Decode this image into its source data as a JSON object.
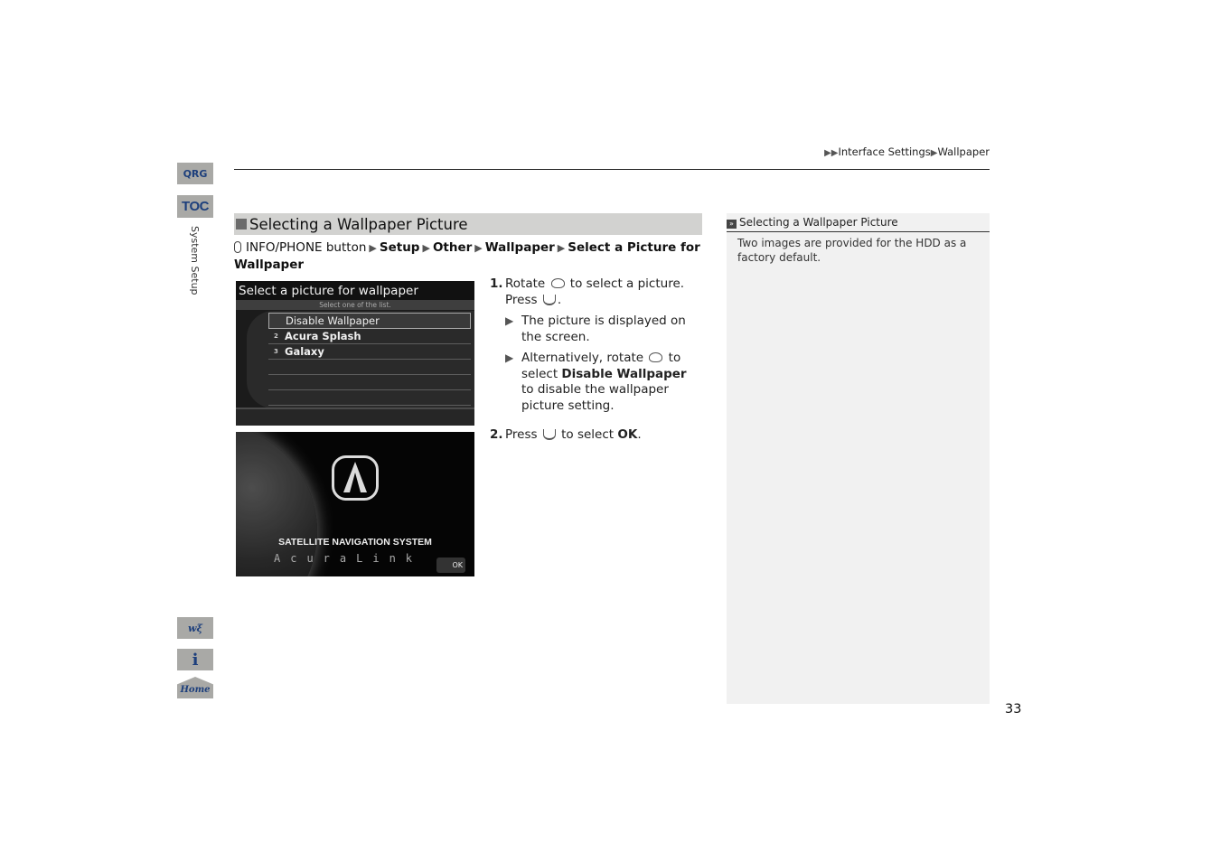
{
  "breadcrumb": {
    "prefix_arrows": "▶▶",
    "items": [
      "Interface Settings",
      "Wallpaper"
    ],
    "separator": "▶"
  },
  "side_nav": {
    "qrg": "QRG",
    "toc": "TOC",
    "section": "System Setup",
    "voice_icon": "voice-command-icon",
    "info_icon": "info-icon",
    "home": "Home"
  },
  "section": {
    "title": "Selecting a Wallpaper Picture",
    "path": {
      "start": "INFO/PHONE button",
      "steps": [
        "Setup",
        "Other",
        "Wallpaper",
        "Select a Picture for Wallpaper"
      ]
    }
  },
  "screen1": {
    "title": "Select a picture for wallpaper",
    "subtitle": "Select one of the list.",
    "items": [
      {
        "num": "",
        "label": "Disable Wallpaper",
        "selected": true
      },
      {
        "num": "2",
        "label": "Acura Splash",
        "selected": false
      },
      {
        "num": "3",
        "label": "Galaxy",
        "selected": false
      }
    ]
  },
  "screen2": {
    "heading": "SATELLITE NAVIGATION SYSTEM",
    "brand": "AcuraLink",
    "ok": "OK"
  },
  "steps": [
    {
      "num": "1.",
      "text_a": "Rotate",
      "text_b": "to select a picture.",
      "text_c": "Press",
      "text_d": ".",
      "subs": [
        {
          "text": "The picture is displayed on the screen."
        },
        {
          "a": "Alternatively, rotate",
          "b": "to select",
          "bold": "Disable Wallpaper",
          "c": "to disable the wallpaper picture setting."
        }
      ]
    },
    {
      "num": "2.",
      "text_a": "Press",
      "text_b": "to select",
      "bold": "OK",
      "text_c": "."
    }
  ],
  "note": {
    "title": "Selecting a Wallpaper Picture",
    "body": "Two images are provided for the HDD as a factory default."
  },
  "page_number": "33"
}
